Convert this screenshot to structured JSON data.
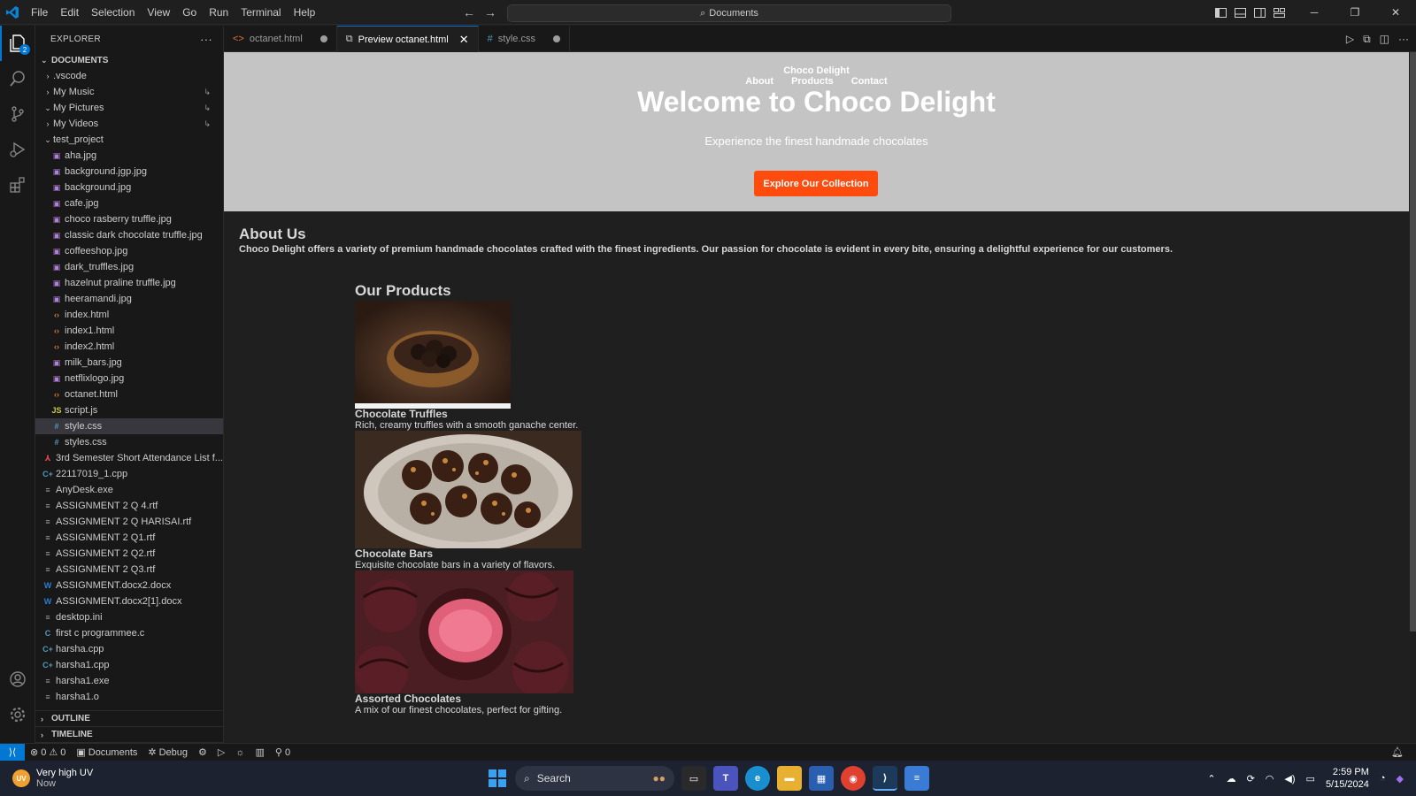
{
  "titlebar": {
    "menu": [
      "File",
      "Edit",
      "Selection",
      "View",
      "Go",
      "Run",
      "Terminal",
      "Help"
    ],
    "search": "Documents"
  },
  "activitybar": {
    "badge": "2"
  },
  "sidebar": {
    "title": "EXPLORER",
    "root": "DOCUMENTS",
    "items": [
      {
        "label": ".vscode",
        "kind": "folder",
        "depth": 1,
        "chev": "›"
      },
      {
        "label": "My Music",
        "kind": "folder",
        "depth": 1,
        "chev": "›",
        "mod": "↳"
      },
      {
        "label": "My Pictures",
        "kind": "folder",
        "depth": 1,
        "chev": "⌄",
        "mod": "↳"
      },
      {
        "label": "My Videos",
        "kind": "folder",
        "depth": 1,
        "chev": "›",
        "mod": "↳"
      },
      {
        "label": "test_project",
        "kind": "folder",
        "depth": 1,
        "chev": "⌄"
      },
      {
        "label": "aha.jpg",
        "kind": "image",
        "depth": 2
      },
      {
        "label": "background.jgp.jpg",
        "kind": "image",
        "depth": 2
      },
      {
        "label": "background.jpg",
        "kind": "image",
        "depth": 2
      },
      {
        "label": "cafe.jpg",
        "kind": "image",
        "depth": 2
      },
      {
        "label": "choco rasberry truffle.jpg",
        "kind": "image",
        "depth": 2
      },
      {
        "label": "classic dark chocolate truffle.jpg",
        "kind": "image",
        "depth": 2
      },
      {
        "label": "coffeeshop.jpg",
        "kind": "image",
        "depth": 2
      },
      {
        "label": "dark_truffles.jpg",
        "kind": "image",
        "depth": 2
      },
      {
        "label": "hazelnut praline truffle.jpg",
        "kind": "image",
        "depth": 2
      },
      {
        "label": "heeramandi.jpg",
        "kind": "image",
        "depth": 2
      },
      {
        "label": "index.html",
        "kind": "html",
        "depth": 2
      },
      {
        "label": "index1.html",
        "kind": "html",
        "depth": 2
      },
      {
        "label": "index2.html",
        "kind": "html",
        "depth": 2
      },
      {
        "label": "milk_bars.jpg",
        "kind": "image",
        "depth": 2
      },
      {
        "label": "netflixlogo.jpg",
        "kind": "image",
        "depth": 2
      },
      {
        "label": "octanet.html",
        "kind": "html",
        "depth": 2
      },
      {
        "label": "script.js",
        "kind": "js",
        "depth": 2
      },
      {
        "label": "style.css",
        "kind": "css",
        "depth": 2,
        "selected": true
      },
      {
        "label": "styles.css",
        "kind": "css",
        "depth": 2
      },
      {
        "label": "3rd Semester Short Attendance List f...",
        "kind": "pdf",
        "depth": 1
      },
      {
        "label": "22117019_1.cpp",
        "kind": "cpp",
        "depth": 1
      },
      {
        "label": "AnyDesk.exe",
        "kind": "text",
        "depth": 1
      },
      {
        "label": "ASSIGNMENT 2 Q 4.rtf",
        "kind": "text",
        "depth": 1
      },
      {
        "label": "ASSIGNMENT 2 Q HARISAI.rtf",
        "kind": "text",
        "depth": 1
      },
      {
        "label": "ASSIGNMENT 2 Q1.rtf",
        "kind": "text",
        "depth": 1
      },
      {
        "label": "ASSIGNMENT 2 Q2.rtf",
        "kind": "text",
        "depth": 1
      },
      {
        "label": "ASSIGNMENT 2 Q3.rtf",
        "kind": "text",
        "depth": 1
      },
      {
        "label": "ASSIGNMENT.docx2.docx",
        "kind": "word",
        "depth": 1
      },
      {
        "label": "ASSIGNMENT.docx2[1].docx",
        "kind": "word",
        "depth": 1
      },
      {
        "label": "desktop.ini",
        "kind": "text",
        "depth": 1
      },
      {
        "label": "first c programmee.c",
        "kind": "c",
        "depth": 1
      },
      {
        "label": "harsha.cpp",
        "kind": "cpp",
        "depth": 1
      },
      {
        "label": "harsha1.cpp",
        "kind": "cpp",
        "depth": 1
      },
      {
        "label": "harsha1.exe",
        "kind": "text",
        "depth": 1
      },
      {
        "label": "harsha1.o",
        "kind": "text",
        "depth": 1
      }
    ],
    "outline": "OUTLINE",
    "timeline": "TIMELINE"
  },
  "tabs": [
    {
      "label": "octanet.html",
      "icon": "<>",
      "dirty": true,
      "active": false
    },
    {
      "label": "Preview octanet.html",
      "icon": "⧉",
      "dirty": false,
      "active": true
    },
    {
      "label": "style.css",
      "icon": "#",
      "dirty": true,
      "active": false
    }
  ],
  "preview": {
    "brand": "Choco Delight",
    "nav": [
      "About",
      "Products",
      "Contact"
    ],
    "headline": "Welcome to Choco Delight",
    "tagline": "Experience the finest handmade chocolates",
    "cta": "Explore Our Collection",
    "about_title": "About Us",
    "about_text": "Choco Delight offers a variety of premium handmade chocolates crafted with the finest ingredients. Our passion for chocolate is evident in every bite, ensuring a delightful experience for our customers.",
    "products_title": "Our Products",
    "products": [
      {
        "name": "Chocolate Truffles",
        "desc": "Rich, creamy truffles with a smooth ganache center."
      },
      {
        "name": "Chocolate Bars",
        "desc": "Exquisite chocolate bars in a variety of flavors."
      },
      {
        "name": "Assorted Chocolates",
        "desc": "A mix of our finest chocolates, perfect for gifting."
      }
    ]
  },
  "statusbar": {
    "errors": "0",
    "warnings": "0",
    "folder": "Documents",
    "debug": "Debug",
    "ports": "0"
  },
  "taskbar": {
    "weather_title": "Very high UV",
    "weather_sub": "Now",
    "search": "Search",
    "time": "2:59 PM",
    "date": "5/15/2024"
  },
  "colors": {
    "accent": "#0078d4",
    "cta": "#ff4b0d",
    "hero_bg": "#c4c4c4"
  }
}
